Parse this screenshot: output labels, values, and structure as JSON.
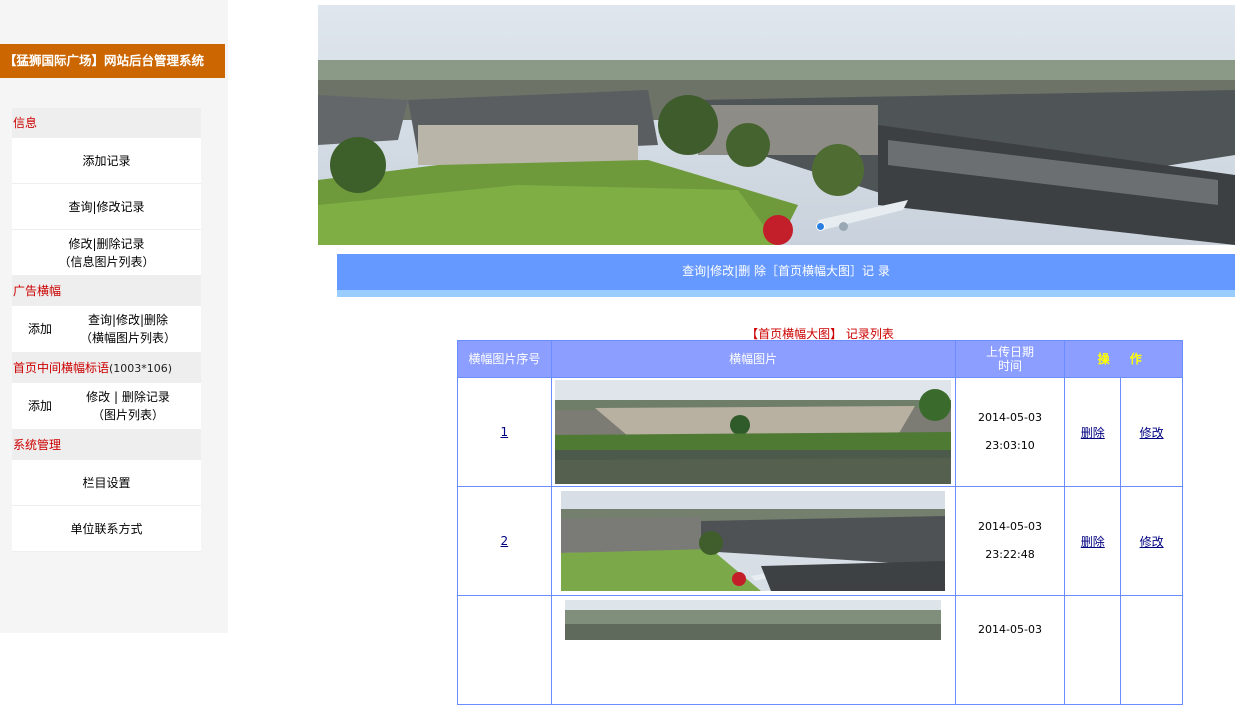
{
  "app": {
    "brand": "【猛狮国际广场】网站后台管理系统"
  },
  "sidebar": {
    "sections": [
      {
        "title": "信息",
        "items": [
          "添加记录",
          "查询|修改记录"
        ],
        "multi": {
          "line1": "修改|删除记录",
          "line2": "（信息图片列表）"
        }
      },
      {
        "title": "广告横幅",
        "add": "添加",
        "links_line1": "查询|修改|删除",
        "links_line2": "（横幅图片列表）"
      },
      {
        "title": "首页中间横幅标语",
        "title_note": "(1003*106)",
        "add": "添加",
        "links_line1": "修改 | 删除记录",
        "links_line2": "（图片列表）"
      },
      {
        "title": "系统管理",
        "items": [
          "栏目设置",
          "单位联系方式"
        ]
      }
    ]
  },
  "main": {
    "header": "查询|修改|删 除［首页横幅大图］记 录",
    "list_title": "【首页横幅大图】 记录列表",
    "columns": {
      "index": "横幅图片序号",
      "image": "横幅图片",
      "date_line1": "上传日期",
      "date_line2": "时间",
      "ops": "操 作"
    },
    "rows": [
      {
        "index": "1",
        "date": "2014-05-03",
        "time": "23:03:10",
        "delete": "删除",
        "edit": "修改"
      },
      {
        "index": "2",
        "date": "2014-05-03",
        "time": "23:22:48",
        "delete": "删除",
        "edit": "修改"
      },
      {
        "index": "",
        "date": "2014-05-03",
        "time": "",
        "delete": "",
        "edit": ""
      }
    ]
  },
  "colors": {
    "brand_bg": "#cc6600",
    "header_bar": "#6699ff",
    "table_header": "#8c9eff",
    "accent_red": "#cc0000"
  }
}
